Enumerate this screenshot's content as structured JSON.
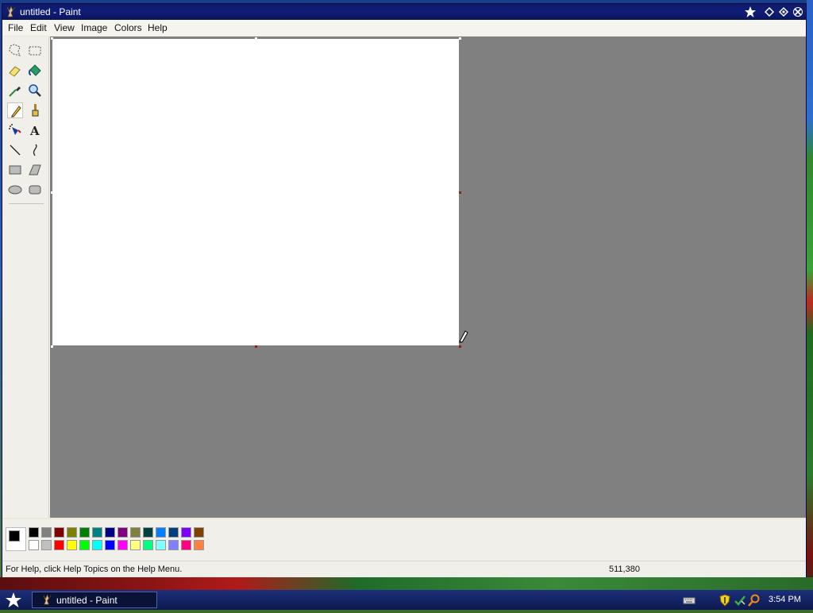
{
  "window": {
    "title": "untitled - Paint",
    "buttons": [
      "pin",
      "restore",
      "maximize",
      "close"
    ]
  },
  "menu": {
    "items": [
      "File",
      "Edit",
      "View",
      "Image",
      "Colors",
      "Help"
    ]
  },
  "toolbox": {
    "tools": [
      "free-select-icon",
      "rect-select-icon",
      "eraser-icon",
      "fill-bucket-icon",
      "color-picker-icon",
      "magnifier-icon",
      "pencil-icon",
      "brush-icon",
      "airbrush-icon",
      "text-icon",
      "line-icon",
      "curve-icon",
      "rectangle-icon",
      "polygon-icon",
      "ellipse-icon",
      "rounded-rect-icon"
    ],
    "selected": "pencil-icon"
  },
  "palette": {
    "foreground": "#000000",
    "background": "#ffffff",
    "top_row": [
      "#000000",
      "#808080",
      "#800000",
      "#808000",
      "#008000",
      "#008080",
      "#000080",
      "#800080",
      "#808040",
      "#004040",
      "#0080ff",
      "#004080",
      "#8000ff",
      "#804000"
    ],
    "bottom_row": [
      "#ffffff",
      "#c0c0c0",
      "#ff0000",
      "#ffff00",
      "#00ff00",
      "#00ffff",
      "#0000ff",
      "#ff00ff",
      "#ffff80",
      "#00ff80",
      "#80ffff",
      "#8080ff",
      "#ff0080",
      "#ff8040"
    ]
  },
  "status": {
    "help_text": "For Help, click Help Topics on the Help Menu.",
    "coords": "511,380"
  },
  "taskbar": {
    "task_label": "untitled - Paint",
    "clock": "3:54 PM"
  }
}
